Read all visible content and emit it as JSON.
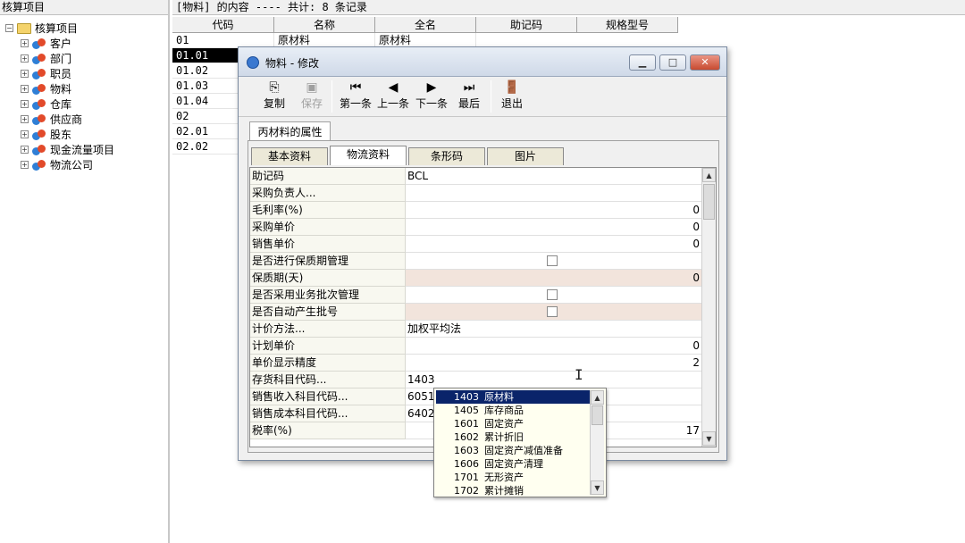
{
  "left": {
    "header": "核算项目",
    "root_label": "核算项目",
    "items": [
      {
        "label": "客户",
        "icon": "customer-icon"
      },
      {
        "label": "部门",
        "icon": "department-icon"
      },
      {
        "label": "职员",
        "icon": "staff-icon"
      },
      {
        "label": "物料",
        "icon": "material-icon"
      },
      {
        "label": "仓库",
        "icon": "warehouse-icon"
      },
      {
        "label": "供应商",
        "icon": "supplier-icon"
      },
      {
        "label": "股东",
        "icon": "shareholder-icon"
      },
      {
        "label": "现金流量项目",
        "icon": "cashflow-icon"
      },
      {
        "label": "物流公司",
        "icon": "logistics-icon"
      }
    ]
  },
  "list": {
    "header": "[物料] 的内容 ---- 共计: 8 条记录",
    "columns": [
      "代码",
      "名称",
      "全名",
      "助记码",
      "规格型号"
    ],
    "rows": [
      [
        "01",
        "原材料",
        "原材料"
      ],
      [
        "01.01",
        "",
        ""
      ],
      [
        "01.02",
        "",
        ""
      ],
      [
        "01.03",
        "",
        ""
      ],
      [
        "01.04",
        "",
        ""
      ],
      [
        "02",
        "",
        ""
      ],
      [
        "02.01",
        "",
        ""
      ],
      [
        "02.02",
        "",
        ""
      ]
    ]
  },
  "dialog": {
    "title": "物料 - 修改",
    "toolbar": {
      "copy": "复制",
      "save": "保存",
      "first": "第一条",
      "prev": "上一条",
      "next": "下一条",
      "last": "最后",
      "exit": "退出"
    },
    "property_tab": "丙材料的属性",
    "tabs": [
      "基本资料",
      "物流资料",
      "条形码",
      "图片"
    ],
    "active_tab": 1,
    "properties": [
      {
        "name": "助记码",
        "value": "BCL"
      },
      {
        "name": "采购负责人...",
        "value": ""
      },
      {
        "name": "毛利率(%)",
        "value": "0"
      },
      {
        "name": "采购单价",
        "value": "0"
      },
      {
        "name": "销售单价",
        "value": "0"
      },
      {
        "name": "是否进行保质期管理",
        "value": ""
      },
      {
        "name": "保质期(天)",
        "value": "0"
      },
      {
        "name": "是否采用业务批次管理",
        "value": ""
      },
      {
        "name": "是否自动产生批号",
        "value": ""
      },
      {
        "name": "计价方法...",
        "value": "加权平均法"
      },
      {
        "name": "计划单价",
        "value": "0"
      },
      {
        "name": "单价显示精度",
        "value": "2"
      },
      {
        "name": "存货科目代码...",
        "value": "1403"
      },
      {
        "name": "销售收入科目代码...",
        "value": "6051"
      },
      {
        "name": "销售成本科目代码...",
        "value": "6402"
      },
      {
        "name": "税率(%)",
        "value": "17"
      }
    ]
  },
  "dropdown": {
    "selected_index": 0,
    "items": [
      {
        "code": "1403",
        "name": "原材料"
      },
      {
        "code": "1405",
        "name": "库存商品"
      },
      {
        "code": "1601",
        "name": "固定资产"
      },
      {
        "code": "1602",
        "name": "累计折旧"
      },
      {
        "code": "1603",
        "name": "固定资产减值准备"
      },
      {
        "code": "1606",
        "name": "固定资产清理"
      },
      {
        "code": "1701",
        "name": "无形资产"
      },
      {
        "code": "1702",
        "name": "累计摊销"
      }
    ]
  },
  "colors": {
    "selection": "#0a246a",
    "shaded_row": "#f2e4dc",
    "dropdown_bg": "#fffff0"
  }
}
